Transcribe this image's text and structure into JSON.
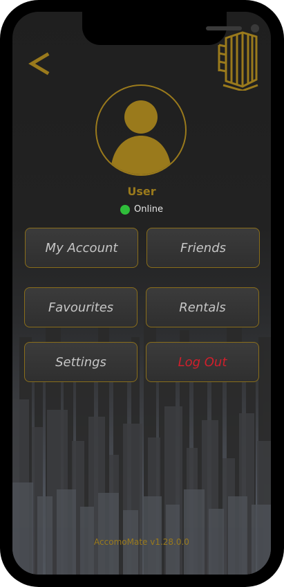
{
  "nav": {
    "back_icon": "chevron-left-icon"
  },
  "logo": {
    "icon": "building-icon"
  },
  "profile": {
    "avatar_icon": "user-avatar-icon",
    "name": "User",
    "status_text": "Online",
    "status_color": "#2fbd3a"
  },
  "menu": {
    "items": [
      {
        "label": "My Account"
      },
      {
        "label": "Friends"
      },
      {
        "label": "Favourites"
      },
      {
        "label": "Rentals"
      },
      {
        "label": "Settings"
      },
      {
        "label": "Log Out"
      }
    ]
  },
  "footer": {
    "version": "AccomoMate v1.28.0.0"
  },
  "theme": {
    "accent": "#9a7a1c",
    "danger": "#d11f2c",
    "background": "#222222"
  }
}
